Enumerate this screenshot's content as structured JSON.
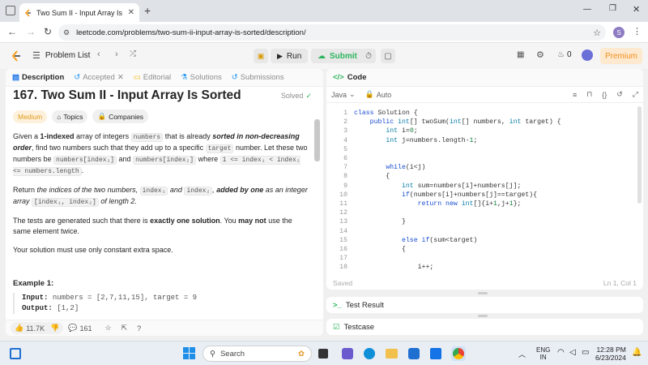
{
  "browser": {
    "tab_title": "Two Sum II - Input Array Is Sort",
    "url": "leetcode.com/problems/two-sum-ii-input-array-is-sorted/description/",
    "profile_initial": "S"
  },
  "nav": {
    "problem_list": "Problem List",
    "run": "Run",
    "submit": "Submit",
    "streak": "0",
    "premium": "Premium"
  },
  "left_tabs": {
    "description": "Description",
    "accepted": "Accepted",
    "editorial": "Editorial",
    "solutions": "Solutions",
    "submissions": "Submissions"
  },
  "problem": {
    "title": "167. Two Sum II - Input Array Is Sorted",
    "status": "Solved",
    "difficulty": "Medium",
    "topics": "Topics",
    "companies": "Companies",
    "p1": {
      "a": "Given a ",
      "b": "1-indexed",
      "c": " array of integers ",
      "d": "numbers",
      "e": " that is already ",
      "f": "sorted in non-decreasing order",
      "g": ", find two numbers such that they add up to a specific ",
      "h": "target",
      "i": " number. Let these two numbers be ",
      "j": "numbers[index₁]",
      "k": " and ",
      "l": "numbers[index₂]",
      "m": " where ",
      "n": "1 <= index₁ < index₂ <= numbers.length",
      "o": "."
    },
    "p2": {
      "a": "Return ",
      "b": "the indices of the two numbers, ",
      "c": "index₁",
      "d": " and ",
      "e": "index₂",
      "f": ", ",
      "g": "added by one",
      "h": " as an integer array ",
      "i": "[index₁, index₂]",
      "j": " of length 2."
    },
    "p3": {
      "a": "The tests are generated such that there is ",
      "b": "exactly one solution",
      "c": ". You ",
      "d": "may not",
      "e": " use the same element twice."
    },
    "p4": "Your solution must use only constant extra space.",
    "example_title": "Example 1:",
    "example_input_label": "Input:",
    "example_input": "numbers = [2,7,11,15], target = 9",
    "example_output_label": "Output:",
    "example_output": "[1,2]",
    "likes": "11.7K",
    "comments": "161"
  },
  "editor": {
    "header": "Code",
    "language": "Java",
    "mode": "Auto",
    "saved": "Saved",
    "cursor": "Ln 1, Col 1",
    "lines": [
      {
        "n": "1",
        "t": "class Solution {"
      },
      {
        "n": "2",
        "t": "    public int[] twoSum(int[] numbers, int target) {"
      },
      {
        "n": "3",
        "t": "        int i=0;"
      },
      {
        "n": "4",
        "t": "        int j=numbers.length-1;"
      },
      {
        "n": "5",
        "t": ""
      },
      {
        "n": "6",
        "t": ""
      },
      {
        "n": "7",
        "t": "        while(i<j)"
      },
      {
        "n": "8",
        "t": "        {"
      },
      {
        "n": "9",
        "t": "            int sum=numbers[i]+numbers[j];"
      },
      {
        "n": "10",
        "t": "            if(numbers[i]+numbers[j]==target){"
      },
      {
        "n": "11",
        "t": "                return new int[]{i+1,j+1};"
      },
      {
        "n": "12",
        "t": ""
      },
      {
        "n": "13",
        "t": "            }"
      },
      {
        "n": "14",
        "t": ""
      },
      {
        "n": "15",
        "t": "            else if(sum<target)"
      },
      {
        "n": "16",
        "t": "            {"
      },
      {
        "n": "17",
        "t": ""
      },
      {
        "n": "18",
        "t": "                i++;"
      }
    ]
  },
  "panels": {
    "test_result": "Test Result",
    "testcase": "Testcase"
  },
  "taskbar": {
    "search": "Search",
    "lang1": "ENG",
    "lang2": "IN",
    "time": "12:28 PM",
    "date": "6/23/2024"
  }
}
